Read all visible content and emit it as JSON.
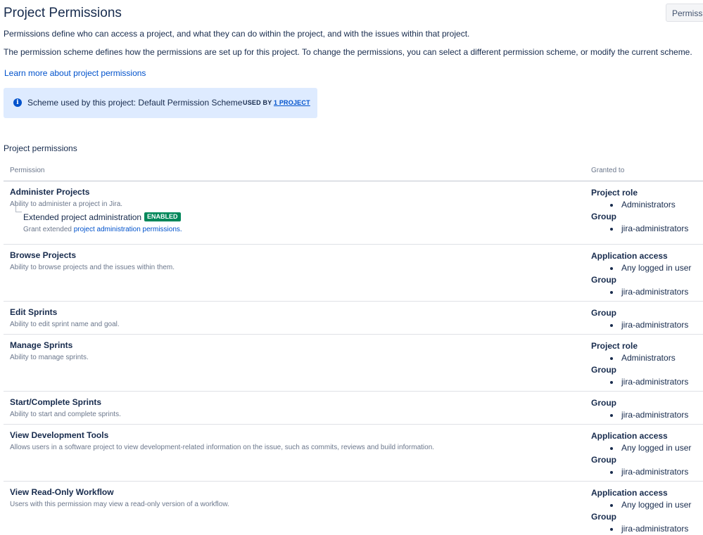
{
  "header": {
    "title": "Project Permissions",
    "actions_label": "Permissions"
  },
  "intro": {
    "line1": "Permissions define who can access a project, and what they can do within the project, and with the issues within that project.",
    "line2": "The permission scheme defines how the permissions are set up for this project. To change the permissions, you can select a different permission scheme, or modify the current scheme.",
    "learn_more": "Learn more about project permissions"
  },
  "scheme": {
    "text": "Scheme used by this project: Default Permission Scheme",
    "used_by_label": "USED BY",
    "used_by_link": "1 PROJECT"
  },
  "section": {
    "heading": "Project permissions",
    "col_permission": "Permission",
    "col_granted": "Granted to"
  },
  "permissions": [
    {
      "name": "Administer Projects",
      "desc": "Ability to administer a project in Jira.",
      "extended": {
        "name": "Extended project administration",
        "badge": "ENABLED",
        "desc_prefix": "Grant extended",
        "desc_link": "project administration permissions."
      },
      "grants": [
        {
          "type": "Project role",
          "items": [
            "Administrators"
          ]
        },
        {
          "type": "Group",
          "items": [
            "jira-administrators"
          ]
        }
      ]
    },
    {
      "name": "Browse Projects",
      "desc": "Ability to browse projects and the issues within them.",
      "grants": [
        {
          "type": "Application access",
          "items": [
            "Any logged in user"
          ]
        },
        {
          "type": "Group",
          "items": [
            "jira-administrators"
          ]
        }
      ]
    },
    {
      "name": "Edit Sprints",
      "desc": "Ability to edit sprint name and goal.",
      "grants": [
        {
          "type": "Group",
          "items": [
            "jira-administrators"
          ]
        }
      ]
    },
    {
      "name": "Manage Sprints",
      "desc": "Ability to manage sprints.",
      "grants": [
        {
          "type": "Project role",
          "items": [
            "Administrators"
          ]
        },
        {
          "type": "Group",
          "items": [
            "jira-administrators"
          ]
        }
      ]
    },
    {
      "name": "Start/Complete Sprints",
      "desc": "Ability to start and complete sprints.",
      "grants": [
        {
          "type": "Group",
          "items": [
            "jira-administrators"
          ]
        }
      ]
    },
    {
      "name": "View Development Tools",
      "desc": "Allows users in a software project to view development-related information on the issue, such as commits, reviews and build information.",
      "grants": [
        {
          "type": "Application access",
          "items": [
            "Any logged in user"
          ]
        },
        {
          "type": "Group",
          "items": [
            "jira-administrators"
          ]
        }
      ]
    },
    {
      "name": "View Read-Only Workflow",
      "desc": "Users with this permission may view a read-only version of a workflow.",
      "grants": [
        {
          "type": "Application access",
          "items": [
            "Any logged in user"
          ]
        },
        {
          "type": "Group",
          "items": [
            "jira-administrators"
          ]
        }
      ]
    }
  ]
}
